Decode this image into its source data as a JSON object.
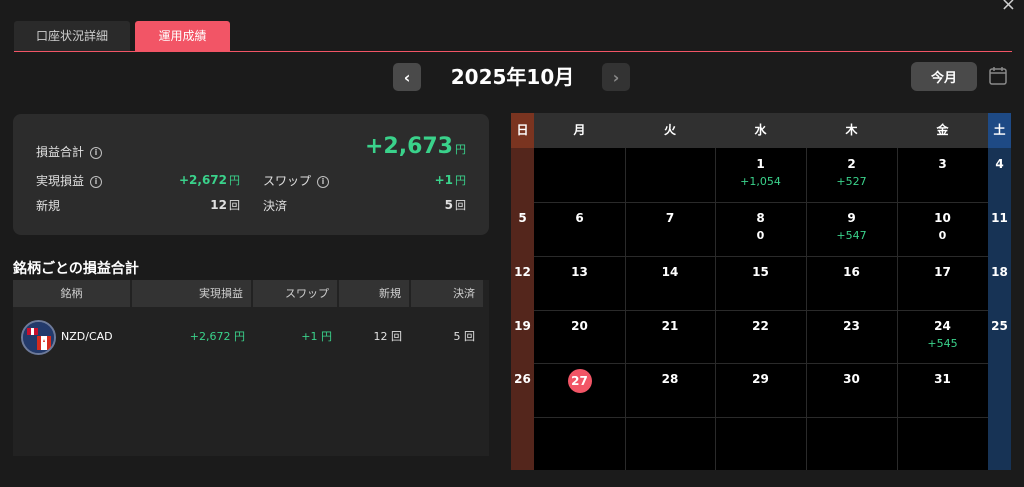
{
  "tabs": [
    {
      "label": "口座状況詳細",
      "active": false
    },
    {
      "label": "運用成績",
      "active": true
    }
  ],
  "close_label": "×",
  "nav": {
    "prev": "‹",
    "next": "›",
    "month": "2025年10月",
    "today": "今月"
  },
  "summary": {
    "total_label": "損益合計",
    "total_value": "+2,673",
    "total_unit": "円",
    "realized_label": "実現損益",
    "realized_value": "+2,672",
    "realized_unit": "円",
    "swap_label": "スワップ",
    "swap_value": "+1",
    "swap_unit": "円",
    "new_label": "新規",
    "new_value": "12",
    "new_unit": "回",
    "settle_label": "決済",
    "settle_value": "5",
    "settle_unit": "回"
  },
  "symbols": {
    "title": "銘柄ごとの損益合計",
    "headers": [
      "銘柄",
      "実現損益",
      "スワップ",
      "新規",
      "決済"
    ],
    "rows": [
      {
        "symbol": "NZD/CAD",
        "realized": "+2,672 円",
        "swap": "+1 円",
        "new": "12 回",
        "settle": "5 回"
      }
    ]
  },
  "calendar": {
    "weekdays": [
      "日",
      "月",
      "火",
      "水",
      "木",
      "金",
      "土"
    ],
    "today": "27",
    "weeks": [
      [
        {
          "d": "",
          "v": ""
        },
        {
          "d": "",
          "v": ""
        },
        {
          "d": "",
          "v": ""
        },
        {
          "d": "1",
          "v": "+1,054"
        },
        {
          "d": "2",
          "v": "+527"
        },
        {
          "d": "3",
          "v": ""
        },
        {
          "d": "4",
          "v": ""
        }
      ],
      [
        {
          "d": "5",
          "v": ""
        },
        {
          "d": "6",
          "v": ""
        },
        {
          "d": "7",
          "v": ""
        },
        {
          "d": "8",
          "v": "0"
        },
        {
          "d": "9",
          "v": "+547"
        },
        {
          "d": "10",
          "v": "0"
        },
        {
          "d": "11",
          "v": ""
        }
      ],
      [
        {
          "d": "12",
          "v": ""
        },
        {
          "d": "13",
          "v": ""
        },
        {
          "d": "14",
          "v": ""
        },
        {
          "d": "15",
          "v": ""
        },
        {
          "d": "16",
          "v": ""
        },
        {
          "d": "17",
          "v": ""
        },
        {
          "d": "18",
          "v": ""
        }
      ],
      [
        {
          "d": "19",
          "v": ""
        },
        {
          "d": "20",
          "v": ""
        },
        {
          "d": "21",
          "v": ""
        },
        {
          "d": "22",
          "v": ""
        },
        {
          "d": "23",
          "v": ""
        },
        {
          "d": "24",
          "v": "+545"
        },
        {
          "d": "25",
          "v": ""
        }
      ],
      [
        {
          "d": "26",
          "v": ""
        },
        {
          "d": "27",
          "v": ""
        },
        {
          "d": "28",
          "v": ""
        },
        {
          "d": "29",
          "v": ""
        },
        {
          "d": "30",
          "v": ""
        },
        {
          "d": "31",
          "v": ""
        },
        {
          "d": "",
          "v": ""
        }
      ],
      [
        {
          "d": "",
          "v": ""
        },
        {
          "d": "",
          "v": ""
        },
        {
          "d": "",
          "v": ""
        },
        {
          "d": "",
          "v": ""
        },
        {
          "d": "",
          "v": ""
        },
        {
          "d": "",
          "v": ""
        },
        {
          "d": "",
          "v": ""
        }
      ]
    ]
  }
}
